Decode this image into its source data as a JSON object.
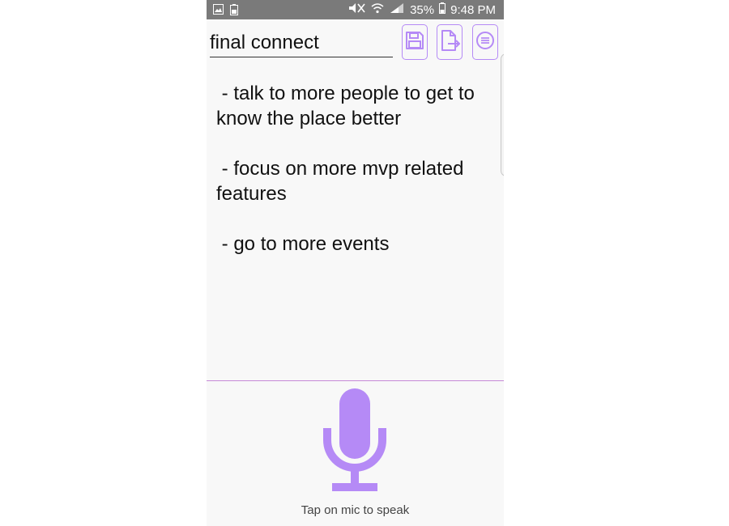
{
  "status_bar": {
    "battery_percent": "35%",
    "time": "9:48 PM",
    "left_icons": [
      "gallery-icon",
      "battery-saver-icon"
    ],
    "right_icons": [
      "mute-icon",
      "wifi-icon",
      "signal-icon",
      "battery-icon"
    ]
  },
  "toolbar": {
    "title_value": "final connect",
    "buttons": [
      "save-icon",
      "export-icon",
      "menu-icon"
    ]
  },
  "note": {
    "text": " - talk to more people to get to\nknow the place better\n\n - focus on more mvp related\nfeatures\n\n - go to more events"
  },
  "mic": {
    "hint": "Tap on mic to speak",
    "icon": "microphone-icon"
  },
  "colors": {
    "accent": "#b58af6",
    "divider": "#c68ad8",
    "status_bar": "#7a7a7a",
    "background": "#f8f8f8"
  }
}
